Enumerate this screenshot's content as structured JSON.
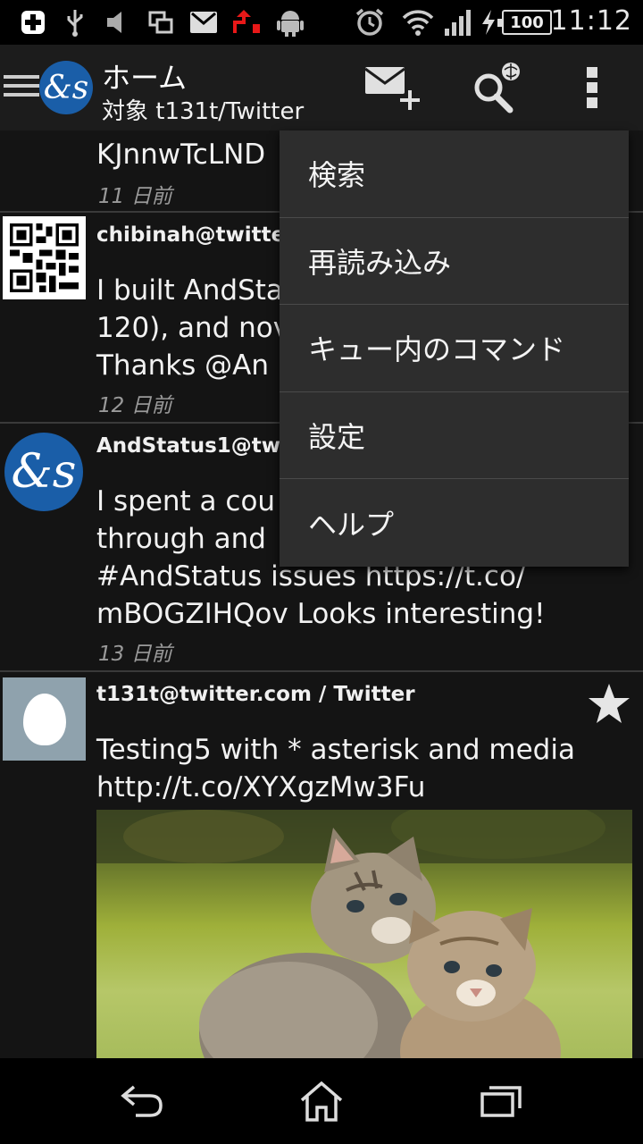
{
  "status_bar": {
    "time": "11:12",
    "battery": "100",
    "icons": [
      "add-icon",
      "usb-icon",
      "mute-icon",
      "screen-mirror-icon",
      "gmail-icon",
      "upload-icon",
      "android-icon",
      "alarm-icon",
      "wifi-icon",
      "signal-icon",
      "charging-icon",
      "battery-icon"
    ]
  },
  "action_bar": {
    "logo_text": "&s",
    "title": "ホーム",
    "subtitle": "対象 t131t/Twitter",
    "buttons": [
      "compose-icon",
      "search-icon",
      "overflow-icon"
    ]
  },
  "timeline": [
    {
      "partial_text": "KJnnwTcLND",
      "date": "11 日前"
    },
    {
      "author": "chibinah@twitte",
      "lines": [
        "I built AndSta",
        "120), and nov",
        "Thanks @An"
      ],
      "date": "12 日前",
      "avatar": "qr-code"
    },
    {
      "author": "AndStatus1@twi",
      "lines": [
        "I spent a cou",
        "through and",
        "#AndStatus issues https://t.co/",
        "mBOGZIHQov Looks interesting!"
      ],
      "date": "13 日前",
      "avatar": "andstatus-logo",
      "avatar_text": "&s"
    },
    {
      "author": "t131t@twitter.com / Twitter",
      "lines": [
        "Testing5 with * asterisk and media",
        "http://t.co/XYXgzMw3Fu"
      ],
      "avatar": "egg",
      "favorited": true,
      "attachment": "kittens-photo"
    }
  ],
  "overflow_menu": {
    "items": [
      "検索",
      "再読み込み",
      "キュー内のコマンド",
      "設定",
      "ヘルプ"
    ]
  },
  "nav_bar": {
    "buttons": [
      "back-icon",
      "home-icon",
      "recents-icon"
    ]
  },
  "colors": {
    "background": "#141414",
    "action_bar": "#1c1c1c",
    "menu": "#2d2d2d",
    "logo_blue": "#1a5ea8",
    "date_gray": "#9a9a9a"
  }
}
